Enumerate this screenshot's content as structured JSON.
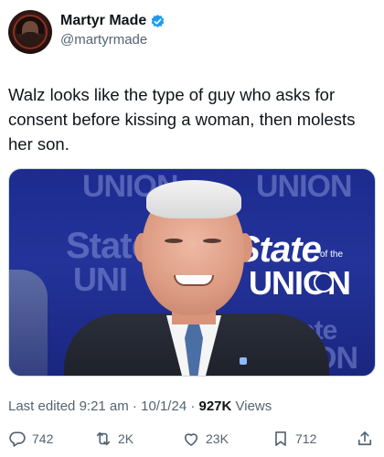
{
  "author": {
    "display_name": "Martyr Made",
    "handle": "@martyrmade",
    "verified": true,
    "avatar_icon": "avatar-portrait"
  },
  "tweet": {
    "text": "Walz looks like the type of guy who asks for consent before kissing a woman, then molests her son."
  },
  "media": {
    "bg_words": [
      "UNION",
      "UNION",
      "State",
      "UNI",
      "ON",
      "State"
    ],
    "logo_state": "State",
    "logo_ofthe": "of the",
    "logo_union": "UNION"
  },
  "meta": {
    "edited_prefix": "Last edited ",
    "time": "9:21 am",
    "separator": " · ",
    "date": "10/1/24",
    "views_count": "927K",
    "views_label": " Views"
  },
  "actions": {
    "replies": "742",
    "reposts": "2K",
    "likes": "23K",
    "bookmarks": "712"
  },
  "colors": {
    "accent": "#1d9bf0",
    "text": "#0f1419",
    "muted": "#536471"
  }
}
